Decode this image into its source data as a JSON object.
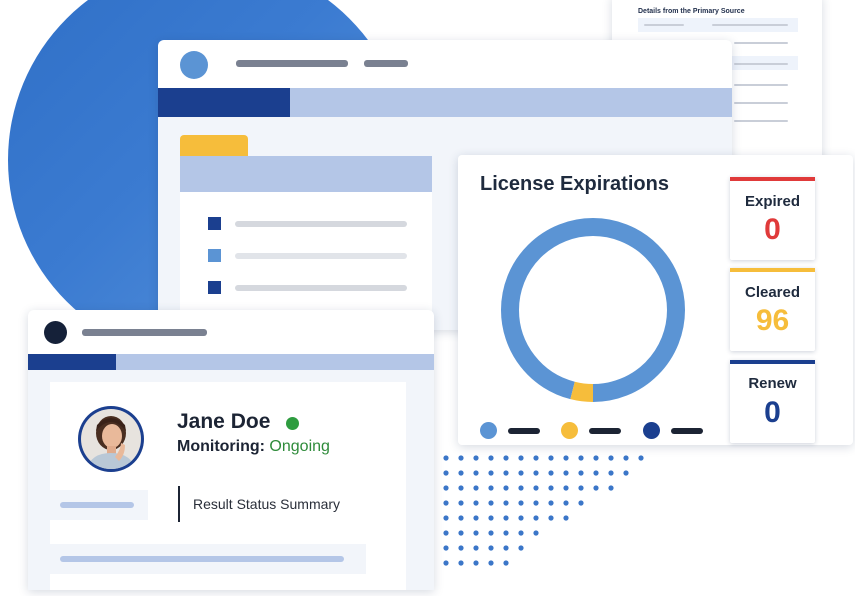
{
  "back_document": {
    "title": "Details from the Primary Source"
  },
  "license_card": {
    "title": "License Expirations",
    "stats": [
      {
        "label": "Expired",
        "value": "0",
        "color": "#e03a3a"
      },
      {
        "label": "Cleared",
        "value": "96",
        "color": "#f6bd3b"
      },
      {
        "label": "Renew",
        "value": "0",
        "color": "#1b3f8f"
      }
    ],
    "donut": {
      "segments": [
        {
          "name": "cleared",
          "value": 96,
          "color": "#5b94d4"
        },
        {
          "name": "expiring",
          "value": 4,
          "color": "#f6bd3b"
        }
      ]
    },
    "legend_colors": [
      "#5b94d4",
      "#f6bd3b",
      "#1b3f8f"
    ]
  },
  "profile": {
    "name": "Jane Doe",
    "status_color": "#2e9c3f",
    "monitoring_label": "Monitoring:",
    "monitoring_value": "Ongoing",
    "result_summary": "Result Status Summary"
  },
  "colors": {
    "brand_blue": "#1b3f8f",
    "light_blue": "#b4c6e7",
    "accent_yellow": "#f6bd3b"
  }
}
